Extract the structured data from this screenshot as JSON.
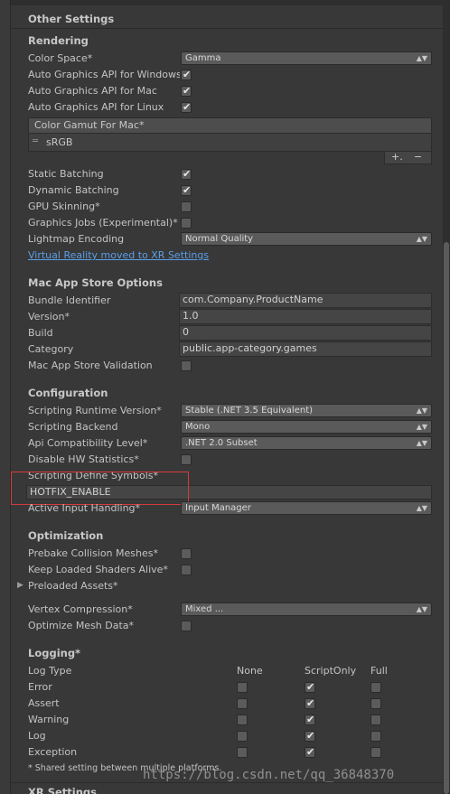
{
  "header": {
    "title": "Other Settings"
  },
  "rendering": {
    "title": "Rendering",
    "color_space": {
      "label": "Color Space*",
      "value": "Gamma"
    },
    "auto_api_windows": {
      "label": "Auto Graphics API for Windows",
      "checked": true
    },
    "auto_api_mac": {
      "label": "Auto Graphics API for Mac",
      "checked": true
    },
    "auto_api_linux": {
      "label": "Auto Graphics API for Linux",
      "checked": true
    },
    "color_gamut": {
      "header": "Color Gamut For Mac*",
      "items": [
        "sRGB"
      ],
      "add_glyph": "+.",
      "remove_glyph": "−"
    },
    "static_batching": {
      "label": "Static Batching",
      "checked": true
    },
    "dynamic_batching": {
      "label": "Dynamic Batching",
      "checked": true
    },
    "gpu_skinning": {
      "label": "GPU Skinning*",
      "checked": false
    },
    "graphics_jobs": {
      "label": "Graphics Jobs (Experimental)*",
      "checked": false
    },
    "lightmap_encoding": {
      "label": "Lightmap Encoding",
      "value": "Normal Quality"
    },
    "vr_link": "Virtual Reality moved to XR Settings"
  },
  "mac_app_store": {
    "title": "Mac App Store Options",
    "bundle_identifier": {
      "label": "Bundle Identifier",
      "value": "com.Company.ProductName"
    },
    "version": {
      "label": "Version*",
      "value": "1.0"
    },
    "build": {
      "label": "Build",
      "value": "0"
    },
    "category": {
      "label": "Category",
      "value": "public.app-category.games"
    },
    "validation": {
      "label": "Mac App Store Validation",
      "checked": false
    }
  },
  "configuration": {
    "title": "Configuration",
    "runtime_version": {
      "label": "Scripting Runtime Version*",
      "value": "Stable (.NET 3.5 Equivalent)"
    },
    "backend": {
      "label": "Scripting Backend",
      "value": "Mono"
    },
    "api_compat": {
      "label": "Api Compatibility Level*",
      "value": ".NET 2.0 Subset"
    },
    "disable_hw_stats": {
      "label": "Disable HW Statistics*",
      "checked": false
    },
    "define_symbols": {
      "label": "Scripting Define Symbols*",
      "value": "HOTFIX_ENABLE"
    },
    "input_handling": {
      "label": "Active Input Handling*",
      "value": "Input Manager"
    }
  },
  "optimization": {
    "title": "Optimization",
    "prebake": {
      "label": "Prebake Collision Meshes*",
      "checked": false
    },
    "keep_shaders": {
      "label": "Keep Loaded Shaders Alive*",
      "checked": false
    },
    "preloaded_assets": {
      "label": "Preloaded Assets*"
    },
    "vertex_compression": {
      "label": "Vertex Compression*",
      "value": "Mixed ..."
    },
    "optimize_mesh": {
      "label": "Optimize Mesh Data*",
      "checked": false
    }
  },
  "logging": {
    "title": "Logging*",
    "col_type": "Log Type",
    "col_none": "None",
    "col_script": "ScriptOnly",
    "col_full": "Full",
    "rows": [
      {
        "name": "Error",
        "none": false,
        "script": true,
        "full": false
      },
      {
        "name": "Assert",
        "none": false,
        "script": true,
        "full": false
      },
      {
        "name": "Warning",
        "none": false,
        "script": true,
        "full": false
      },
      {
        "name": "Log",
        "none": false,
        "script": true,
        "full": false
      },
      {
        "name": "Exception",
        "none": false,
        "script": true,
        "full": false
      }
    ],
    "footnote": "* Shared setting between multiple platforms."
  },
  "xr_settings": {
    "title": "XR Settings"
  },
  "watermark": "https://blog.csdn.net/qq_36848370"
}
